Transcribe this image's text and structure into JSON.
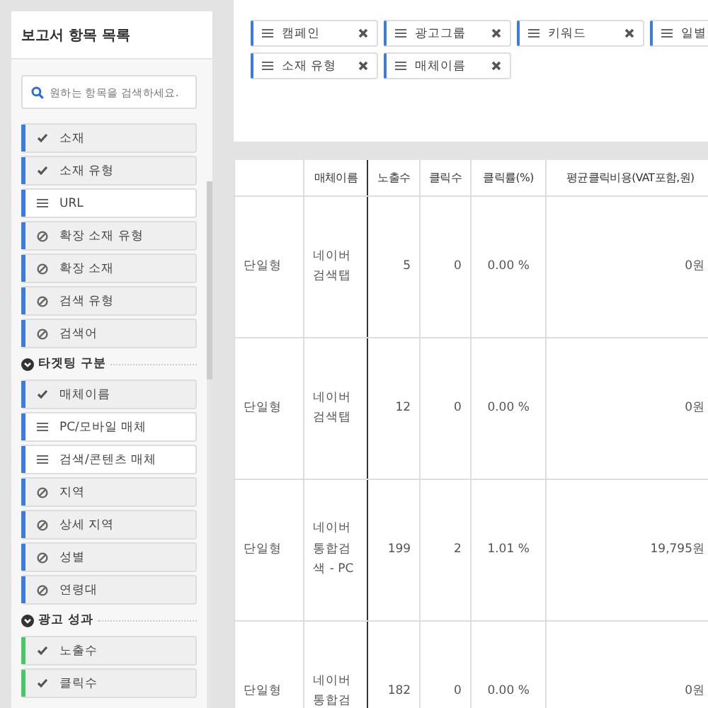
{
  "sidebar": {
    "title": "보고서 항목 목록",
    "search": {
      "placeholder": "원하는 항목을 검색하세요."
    },
    "groups": [
      {
        "items": [
          {
            "label": "소재",
            "kind": "check",
            "color": "#3b7dd8"
          },
          {
            "label": "소재 유형",
            "kind": "check",
            "color": "#3b7dd8"
          },
          {
            "label": "URL",
            "kind": "list",
            "color": "#3b7dd8"
          },
          {
            "label": "확장 소재 유형",
            "kind": "ban",
            "color": "#3b7dd8"
          },
          {
            "label": "확장 소재",
            "kind": "ban",
            "color": "#3b7dd8"
          },
          {
            "label": "검색 유형",
            "kind": "ban",
            "color": "#3b7dd8"
          },
          {
            "label": "검색어",
            "kind": "ban",
            "color": "#3b7dd8"
          }
        ]
      },
      {
        "title": "타겟팅 구분",
        "items": [
          {
            "label": "매체이름",
            "kind": "check",
            "color": "#3b7dd8"
          },
          {
            "label": "PC/모바일 매체",
            "kind": "list",
            "color": "#3b7dd8"
          },
          {
            "label": "검색/콘텐츠 매체",
            "kind": "list",
            "color": "#3b7dd8"
          },
          {
            "label": "지역",
            "kind": "ban",
            "color": "#3b7dd8"
          },
          {
            "label": "상세 지역",
            "kind": "ban",
            "color": "#3b7dd8"
          },
          {
            "label": "성별",
            "kind": "ban",
            "color": "#3b7dd8"
          },
          {
            "label": "연령대",
            "kind": "ban",
            "color": "#3b7dd8"
          }
        ]
      },
      {
        "title": "광고 성과",
        "items": [
          {
            "label": "노출수",
            "kind": "check",
            "color": "#4cc46a"
          },
          {
            "label": "클릭수",
            "kind": "check",
            "color": "#4cc46a"
          }
        ]
      }
    ]
  },
  "selected_tags": [
    {
      "label": "캠페인",
      "removable": true
    },
    {
      "label": "광고그룹",
      "removable": true
    },
    {
      "label": "키워드",
      "removable": true
    },
    {
      "label": "일별"
    },
    {
      "label": "소재 유형",
      "removable": true
    },
    {
      "label": "매체이름",
      "removable": true
    }
  ],
  "table": {
    "columns": [
      "",
      "매체이름",
      "노출수",
      "클릭수",
      "클릭률(%)",
      "평균클릭비용(VAT포함,원)"
    ],
    "rows": [
      [
        "단일형",
        "네이버 검색탭",
        "5",
        "0",
        "0.00 %",
        "0원"
      ],
      [
        "단일형",
        "네이버 검색탭",
        "12",
        "0",
        "0.00 %",
        "0원"
      ],
      [
        "단일형",
        "네이버 통합검색 - PC",
        "199",
        "2",
        "1.01 %",
        "19,795원"
      ],
      [
        "단일형",
        "네이버 통합검",
        "182",
        "0",
        "0.00 %",
        "0원"
      ]
    ]
  }
}
